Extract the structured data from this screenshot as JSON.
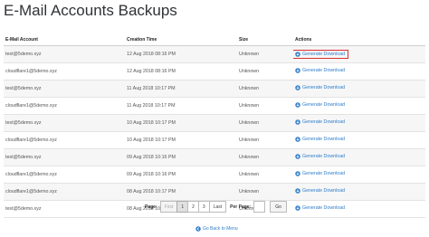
{
  "page": {
    "title": "E-Mail Accounts Backups"
  },
  "table": {
    "headers": {
      "account": "E-Mail Account",
      "time": "Creation Time",
      "size": "Size",
      "actions": "Actions"
    },
    "action_label": "Generate Download",
    "rows": [
      {
        "account": "test@5demo.xyz",
        "time": "12 Aug 2018 08:16 PM",
        "size": "Unknown"
      },
      {
        "account": "cloudflare1@5demo.xyz",
        "time": "12 Aug 2018 08:16 PM",
        "size": "Unknown"
      },
      {
        "account": "test@5demo.xyz",
        "time": "11 Aug 2018 10:17 PM",
        "size": "Unknown"
      },
      {
        "account": "cloudflare1@5demo.xyz",
        "time": "11 Aug 2018 10:17 PM",
        "size": "Unknown"
      },
      {
        "account": "test@5demo.xyz",
        "time": "10 Aug 2018 10:17 PM",
        "size": "Unknown"
      },
      {
        "account": "cloudflare1@5demo.xyz",
        "time": "10 Aug 2018 10:17 PM",
        "size": "Unknown"
      },
      {
        "account": "test@5demo.xyz",
        "time": "09 Aug 2018 10:16 PM",
        "size": "Unknown"
      },
      {
        "account": "cloudflare1@5demo.xyz",
        "time": "09 Aug 2018 10:16 PM",
        "size": "Unknown"
      },
      {
        "account": "cloudflare1@5demo.xyz",
        "time": "08 Aug 2018 10:17 PM",
        "size": "Unknown"
      },
      {
        "account": "test@5demo.xyz",
        "time": "08 Aug 2018 10:17 PM",
        "size": "Unknown"
      }
    ]
  },
  "pagination": {
    "label": "Page:",
    "first": "First",
    "pages": [
      "1",
      "2",
      "3"
    ],
    "current_page": "1",
    "last": "Last",
    "per_page_label": "Per Page:",
    "per_page_value": "",
    "go": "Go"
  },
  "back_link": {
    "label": "Go Back to Menu",
    "icon": "arrow-left-circle-icon"
  },
  "colors": {
    "link": "#2f7dc9",
    "highlight_border": "#d93131"
  }
}
